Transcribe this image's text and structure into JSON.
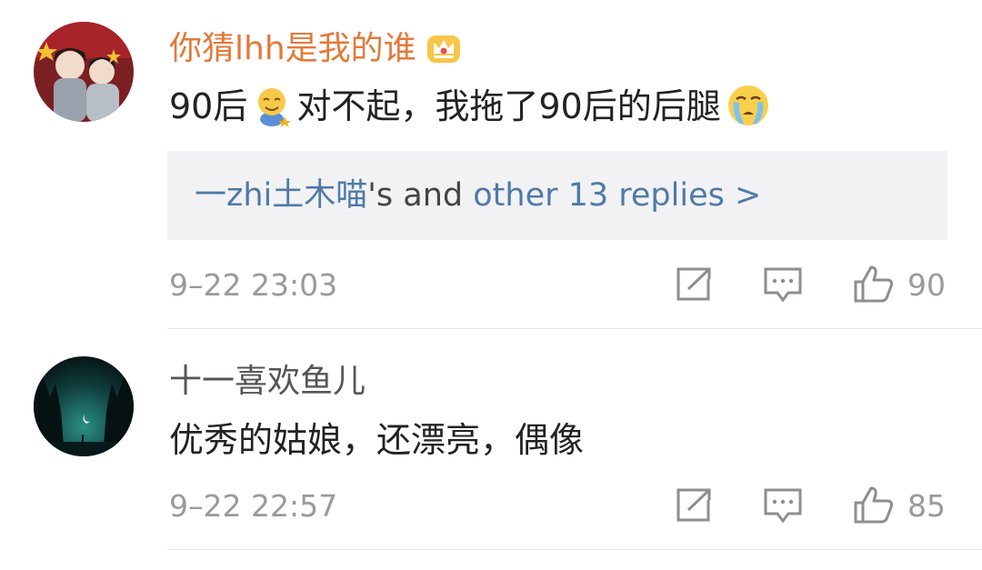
{
  "comments": [
    {
      "username": "你猜lhh是我的谁",
      "text_before_emoji": "90后",
      "text_after_emoji": "对不起，我拖了90后的后腿",
      "replies": {
        "replier": "一zhi土木喵",
        "middle": "'s and ",
        "link": "other 13 replies >"
      },
      "timestamp": "9–22 23:03",
      "likes": "90"
    },
    {
      "username": "十一喜欢鱼儿",
      "text": "优秀的姑娘，还漂亮，偶像",
      "timestamp": "9–22 22:57",
      "likes": "85"
    }
  ],
  "icons": {
    "share": "share-icon",
    "comment": "comment-icon",
    "like": "like-icon",
    "vip": "crown-icon"
  },
  "colors": {
    "vip_name": "#e3793a",
    "link": "#4f7aa8",
    "meta": "#9a9a9a"
  }
}
